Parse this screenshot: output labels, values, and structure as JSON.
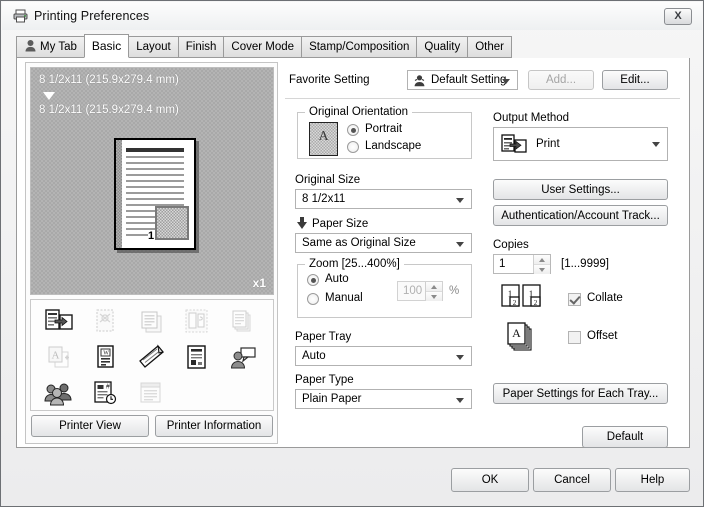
{
  "window": {
    "title": "Printing Preferences",
    "icon": "printer-icon",
    "close_label": "X"
  },
  "tabs": [
    {
      "label": "My Tab",
      "icon": "user-icon",
      "active": false
    },
    {
      "label": "Basic",
      "active": true
    },
    {
      "label": "Layout",
      "active": false
    },
    {
      "label": "Finish",
      "active": false
    },
    {
      "label": "Cover Mode",
      "active": false
    },
    {
      "label": "Stamp/Composition",
      "active": false
    },
    {
      "label": "Quality",
      "active": false
    },
    {
      "label": "Other",
      "active": false
    }
  ],
  "preview": {
    "original_size_label": "8 1/2x11 (215.9x279.4 mm)",
    "paper_size_label": "8 1/2x11 (215.9x279.4 mm)",
    "copies_indicator": "x1",
    "page_number": "1"
  },
  "feature_icons": [
    {
      "name": "output-method-icon",
      "dim": false
    },
    {
      "name": "watermark-icon",
      "dim": true
    },
    {
      "name": "combination-icon",
      "dim": true
    },
    {
      "name": "booklet-icon",
      "dim": true
    },
    {
      "name": "copy-pages-icon",
      "dim": true
    },
    {
      "name": "stamp-text-icon",
      "dim": true
    },
    {
      "name": "overlay-icon",
      "dim": false
    },
    {
      "name": "skew-page-icon",
      "dim": false
    },
    {
      "name": "document-layout-icon",
      "dim": false
    },
    {
      "name": "user-comment-icon",
      "dim": false
    },
    {
      "name": "account-track-icon",
      "dim": false
    },
    {
      "name": "page-number-icon",
      "dim": false
    },
    {
      "name": "banner-page-icon",
      "dim": true
    }
  ],
  "left_buttons": {
    "printer_view": "Printer View",
    "printer_information": "Printer Information"
  },
  "favorite": {
    "label": "Favorite Setting",
    "value": "Default Setting",
    "icon": "favorite-icon",
    "add_label": "Add...",
    "add_disabled": true,
    "edit_label": "Edit...",
    "edit_disabled": false
  },
  "original_orientation": {
    "group_label": "Original Orientation",
    "icon": "portrait-page-icon",
    "options": [
      {
        "label": "Portrait",
        "selected": true,
        "disabled": false
      },
      {
        "label": "Landscape",
        "selected": false,
        "disabled": false
      }
    ]
  },
  "original_size": {
    "label": "Original Size",
    "value": "8 1/2x11"
  },
  "paper_size": {
    "label": "Paper Size",
    "value": "Same as Original Size",
    "icon": "down-arrow-icon"
  },
  "zoom": {
    "group_label": "Zoom [25...400%]",
    "options": [
      {
        "label": "Auto",
        "selected": true
      },
      {
        "label": "Manual",
        "selected": false
      }
    ],
    "value": "100",
    "unit": "%",
    "value_disabled": true
  },
  "paper_tray": {
    "label": "Paper Tray",
    "value": "Auto"
  },
  "paper_type": {
    "label": "Paper Type",
    "value": "Plain Paper"
  },
  "output_method": {
    "label": "Output Method",
    "value": "Print",
    "icon": "print-output-icon"
  },
  "user_settings_button": "User Settings...",
  "authentication_button": "Authentication/Account Track...",
  "copies": {
    "label": "Copies",
    "value": "1",
    "range_hint": "[1...9999]"
  },
  "collate": {
    "label": "Collate",
    "checked": true,
    "icon": "collate-icon"
  },
  "offset": {
    "label": "Offset",
    "checked": false,
    "icon": "offset-stack-icon"
  },
  "paper_settings_button": "Paper Settings for Each Tray...",
  "default_button": "Default",
  "dialog_buttons": {
    "ok": "OK",
    "cancel": "Cancel",
    "help": "Help"
  }
}
